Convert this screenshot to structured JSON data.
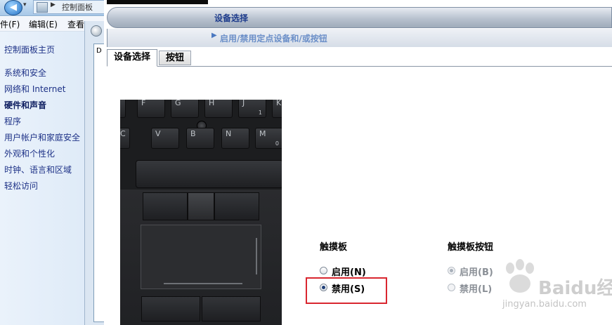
{
  "control_panel": {
    "address_text": "控制面板",
    "menu": {
      "file": "件(F)",
      "edit": "编辑(E)",
      "view": "查看"
    },
    "links": [
      {
        "label": "控制面板主页",
        "bold": false
      },
      {
        "label": "系统和安全",
        "bold": false
      },
      {
        "label": "网络和 Internet",
        "bold": false
      },
      {
        "label": "硬件和声音",
        "bold": true
      },
      {
        "label": "程序",
        "bold": false
      },
      {
        "label": "用户帐户和家庭安全",
        "bold": false
      },
      {
        "label": "外观和个性化",
        "bold": false
      },
      {
        "label": "时钟、语言和区域",
        "bold": false
      },
      {
        "label": "轻松访问",
        "bold": false
      }
    ]
  },
  "frame": {
    "inner_text": "D"
  },
  "dialog": {
    "header_title": "设备选择",
    "subheader_title": "启用/禁用定点设备和/或按钮",
    "tabs": [
      {
        "label": "设备选择",
        "active": true
      },
      {
        "label": "按钮",
        "active": false
      }
    ]
  },
  "keyboard": {
    "row1": [
      "F",
      "G",
      "H",
      "J",
      "K"
    ],
    "row1_sub": {
      "J": "1"
    },
    "row2": [
      "C",
      "V",
      "B",
      "N",
      "M"
    ],
    "row2_sub": {
      "M": "0"
    }
  },
  "touchpad_group": {
    "title": "触摸板",
    "options": [
      {
        "label": "启用(N)",
        "checked": false
      },
      {
        "label": "禁用(S)",
        "checked": true
      }
    ]
  },
  "touchpad_buttons_group": {
    "title": "触摸板按钮",
    "options": [
      {
        "label": "启用(B)",
        "checked": true,
        "disabled": true
      },
      {
        "label": "禁用(L)",
        "checked": false,
        "disabled": true
      }
    ]
  },
  "watermark": {
    "brand": "Baidu经验",
    "url": "jingyan.baidu.com"
  },
  "colors": {
    "highlight_box": "#d9262f",
    "header_title": "#1e3c8c",
    "link": "#1e3287"
  },
  "icons": [
    "back-arrow-icon",
    "forward-arrow-icon",
    "control-panel-icon",
    "trackpoint-icon",
    "paw-watermark-icon"
  ]
}
